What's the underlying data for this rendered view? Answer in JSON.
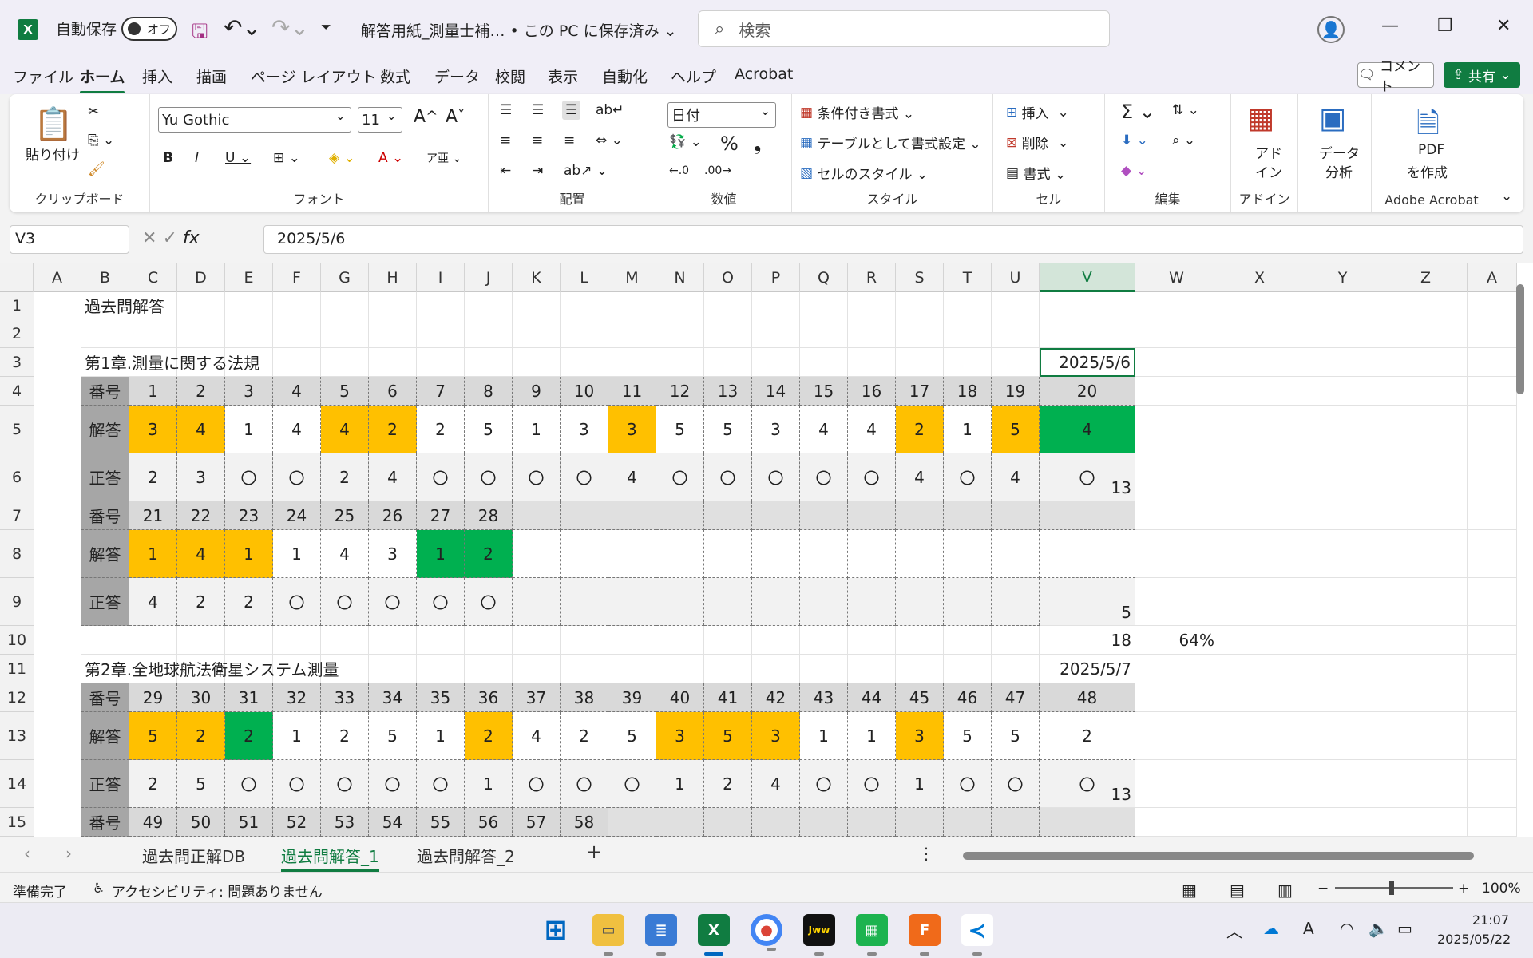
{
  "titlebar": {
    "autosave": "自動保存",
    "toggle": "オフ",
    "doc_title": "解答用紙_測量士補… • この PC に保存済み ⌄",
    "search_placeholder": "検索"
  },
  "menu": [
    "ファイル",
    "ホーム",
    "挿入",
    "描画",
    "ページ レイアウト",
    "数式",
    "データ",
    "校閲",
    "表示",
    "自動化",
    "ヘルプ",
    "Acrobat"
  ],
  "comment_label": "コメント",
  "share_label": "共有",
  "ribbon": {
    "clipboard": {
      "label": "クリップボード",
      "paste": "貼り付け"
    },
    "font": {
      "label": "フォント",
      "name": "Yu Gothic",
      "size": "11"
    },
    "align": {
      "label": "配置"
    },
    "number": {
      "label": "数値",
      "format": "日付"
    },
    "styles": {
      "label": "スタイル",
      "cond": "条件付き書式 ⌄",
      "table": "テーブルとして書式設定 ⌄",
      "cellstyle": "セルのスタイル ⌄"
    },
    "cells": {
      "label": "セル",
      "insert": "挿入",
      "delete": "削除",
      "format": "書式 ⌄"
    },
    "edit": {
      "label": "編集"
    },
    "addin": {
      "label": "アドイン",
      "btn1": "アド",
      "btn2": "イン",
      "analysis1": "データ",
      "analysis2": "分析"
    },
    "acrobat": {
      "label": "Adobe Acrobat",
      "pdf1": "PDF",
      "pdf2": "を作成"
    }
  },
  "formula": {
    "namebox": "V3",
    "value": "2025/5/6"
  },
  "columns": [
    "A",
    "B",
    "C",
    "D",
    "E",
    "F",
    "G",
    "H",
    "I",
    "J",
    "K",
    "L",
    "M",
    "N",
    "O",
    "P",
    "Q",
    "R",
    "S",
    "T",
    "U",
    "V",
    "W",
    "X",
    "Y",
    "Z",
    "A"
  ],
  "rows": [
    "1",
    "2",
    "3",
    "4",
    "5",
    "6",
    "7",
    "8",
    "9",
    "10",
    "11",
    "12",
    "13",
    "14",
    "15"
  ],
  "sheet": {
    "title": "過去問解答",
    "ch1": "第1章.測量に関する法規",
    "ch2": "第2章.全地球航法衛星システム測量",
    "lbl_no": "番号",
    "lbl_ans": "解答",
    "lbl_key": "正答",
    "r4": [
      "1",
      "2",
      "3",
      "4",
      "5",
      "6",
      "7",
      "8",
      "9",
      "10",
      "11",
      "12",
      "13",
      "14",
      "15",
      "16",
      "17",
      "18",
      "19",
      "20"
    ],
    "r5": [
      "3",
      "4",
      "1",
      "4",
      "4",
      "2",
      "2",
      "5",
      "1",
      "3",
      "3",
      "5",
      "5",
      "3",
      "4",
      "4",
      "2",
      "1",
      "5",
      "4"
    ],
    "r6": [
      "2",
      "3",
      "〇",
      "〇",
      "2",
      "4",
      "〇",
      "〇",
      "〇",
      "〇",
      "4",
      "〇",
      "〇",
      "〇",
      "〇",
      "〇",
      "4",
      "〇",
      "4",
      "〇"
    ],
    "r7": [
      "21",
      "22",
      "23",
      "24",
      "25",
      "26",
      "27",
      "28"
    ],
    "r8": [
      "1",
      "4",
      "1",
      "1",
      "4",
      "3",
      "1",
      "2"
    ],
    "r9": [
      "4",
      "2",
      "2",
      "〇",
      "〇",
      "〇",
      "〇",
      "〇"
    ],
    "r12": [
      "29",
      "30",
      "31",
      "32",
      "33",
      "34",
      "35",
      "36",
      "37",
      "38",
      "39",
      "40",
      "41",
      "42",
      "43",
      "44",
      "45",
      "46",
      "47",
      "48"
    ],
    "r13": [
      "5",
      "2",
      "2",
      "1",
      "2",
      "5",
      "1",
      "2",
      "4",
      "2",
      "5",
      "3",
      "5",
      "3",
      "1",
      "1",
      "3",
      "5",
      "5",
      "2"
    ],
    "r14": [
      "2",
      "5",
      "〇",
      "〇",
      "〇",
      "〇",
      "〇",
      "1",
      "〇",
      "〇",
      "〇",
      "1",
      "2",
      "4",
      "〇",
      "〇",
      "1",
      "〇",
      "〇",
      "〇"
    ],
    "r15": [
      "49",
      "50",
      "51",
      "52",
      "53",
      "54",
      "55",
      "56",
      "57",
      "58"
    ],
    "v3": "2025/5/6",
    "v6": "13",
    "v9": "5",
    "v10": "18",
    "w10": "64%",
    "v11": "2025/5/7",
    "v14": "13"
  },
  "tabs": [
    "過去問正解DB",
    "過去問解答_1",
    "過去問解答_2"
  ],
  "status": {
    "ready": "準備完了",
    "access": "アクセシビリティ: 問題ありません",
    "zoom": "100%"
  },
  "clock": {
    "time": "21:07",
    "date": "2025/05/22"
  },
  "colors": {
    "yellow": "#ffc000",
    "green": "#00b050",
    "accent": "#107c41"
  }
}
